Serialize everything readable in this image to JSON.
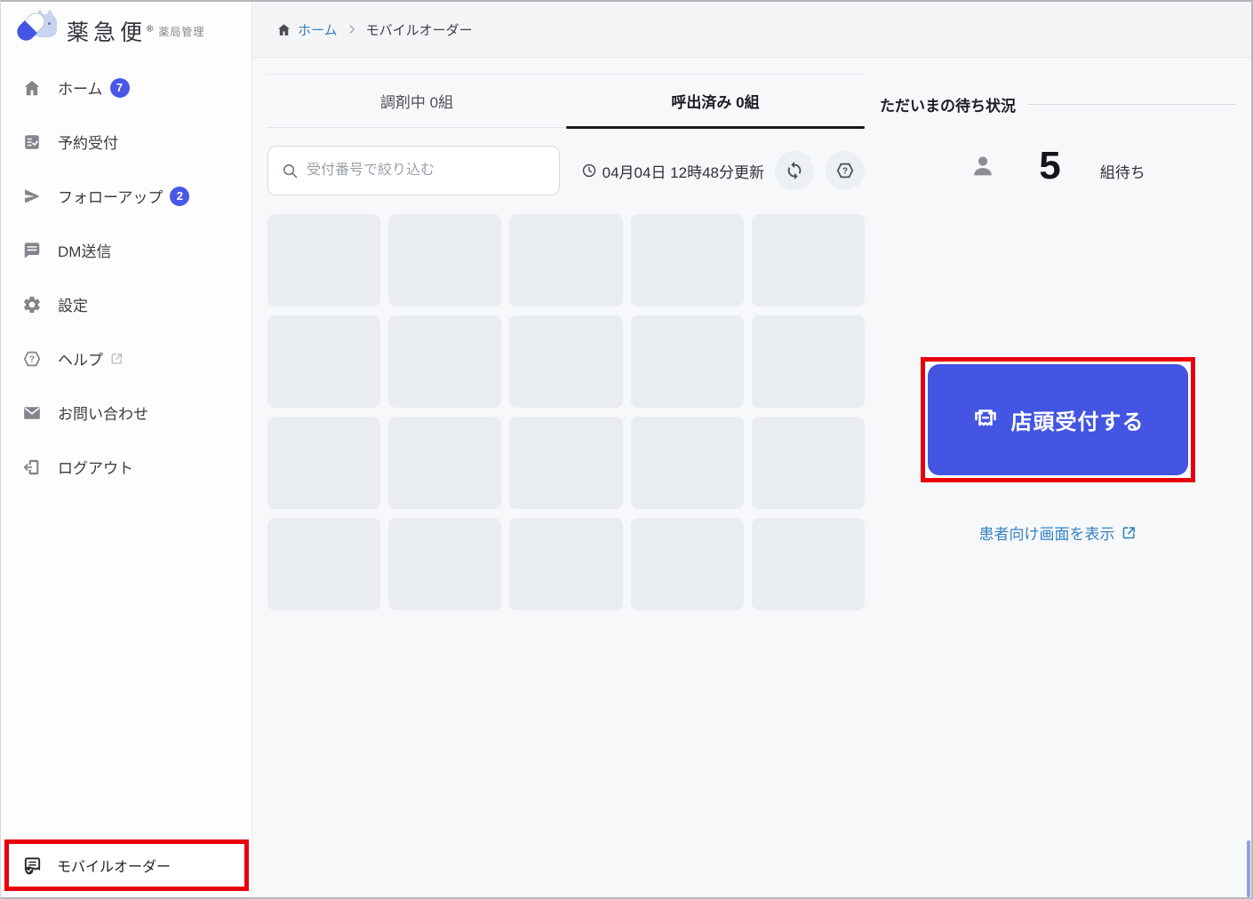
{
  "app": {
    "brand": "薬急便",
    "brand_registered": "®",
    "brand_sub": "薬局管理"
  },
  "sidebar": {
    "items": [
      {
        "label": "ホーム",
        "icon": "home-icon",
        "badge": "7"
      },
      {
        "label": "予約受付",
        "icon": "reservation-list-icon"
      },
      {
        "label": "フォローアップ",
        "icon": "send-icon",
        "badge": "2"
      },
      {
        "label": "DM送信",
        "icon": "message-icon"
      },
      {
        "label": "設定",
        "icon": "gear-icon"
      },
      {
        "label": "ヘルプ",
        "icon": "help-hexagon-icon",
        "external": true
      },
      {
        "label": "お問い合わせ",
        "icon": "mail-icon"
      },
      {
        "label": "ログアウト",
        "icon": "logout-icon"
      }
    ],
    "bottom_item": {
      "label": "モバイルオーダー",
      "icon": "mobile-order-icon",
      "highlighted": true
    }
  },
  "breadcrumb": {
    "home": "ホーム",
    "current": "モバイルオーダー"
  },
  "tabs": [
    {
      "label": "調剤中 0組",
      "active": false
    },
    {
      "label": "呼出済み 0組",
      "active": true
    }
  ],
  "search": {
    "placeholder": "受付番号で絞り込む",
    "value": ""
  },
  "status_bar": {
    "updated_at": "04月04日 12時48分更新"
  },
  "grid": {
    "columns": 5,
    "rows": 4
  },
  "waiting_panel": {
    "title": "ただいまの待ち状況",
    "count": "5",
    "count_unit": "組待ち",
    "primary_button": "店頭受付する",
    "patient_link": "患者向け画面を表示"
  },
  "colors": {
    "accent_blue": "#4355e2",
    "badge_blue": "#4a58e6",
    "annotation_red": "#e8000d",
    "link_blue": "#3383c4",
    "card_gray": "#e9edf2"
  }
}
